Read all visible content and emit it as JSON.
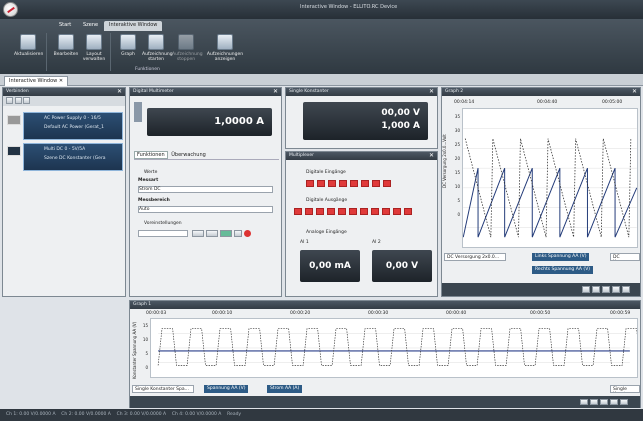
{
  "window": {
    "title": "Interactive Window - ELLITO.RC Device"
  },
  "ribbon": {
    "tabs": [
      "Start",
      "Szene",
      "Interaktive Window"
    ],
    "buttons": [
      "Aktualisieren",
      "Bearbeiten",
      "Layout verwalten",
      "Graph",
      "Aufzeichnung starten",
      "Aufzeichnung stoppen",
      "Aufzeichnungen anzeigen"
    ],
    "group_label": "Funktionen"
  },
  "document_tab": "Interactive Window",
  "devices": {
    "title": "Verbinden",
    "items": [
      {
        "name": "AC Power Supply 0 - 16/5",
        "sub": "Default AC Power (Gerat_1"
      },
      {
        "name": "Multi DC 0 - 5V/5A",
        "sub": "Szene DC Konstanter (Gera"
      }
    ]
  },
  "multimeter": {
    "title": "Digital Multimeter",
    "value": "1,0000 A",
    "tabs": [
      "Funktionen",
      "Überwachung"
    ],
    "section_values": "Werte",
    "mode_label": "Messart",
    "mode_value": "Strom DC",
    "range_label": "Messbereich",
    "range_value": "Auto",
    "section_presets": "Voreinstellungen"
  },
  "constant": {
    "title": "Single Konstanter",
    "voltage": "00,00 V",
    "current": "1,000 A"
  },
  "io": {
    "title": "Multiplexer",
    "din": "Digitale Eingänge",
    "dout": "Digitale Ausgänge",
    "ain": "Analoge Eingänge",
    "ai1_label": "AI 1",
    "ai2_label": "AI 2",
    "ai1": "0,00 mA",
    "ai2": "0,00 V"
  },
  "graph2": {
    "title": "Graph 2",
    "times": [
      "00:04:14",
      "00:04:40",
      "00:05:00"
    ],
    "ylabel": "DC Versorgung 2x0.0...Volt",
    "yticks": [
      "35",
      "30",
      "25",
      "20",
      "15",
      "10",
      "5",
      "0"
    ],
    "select": "DC Versorgung 2x0.0...",
    "leg1": "Links Spannung AA (V)",
    "leg2": "Rechts Spannung AA (V)",
    "select2": "DC Versorgung"
  },
  "graph1": {
    "title": "Graph 1",
    "times": [
      "00:00:03",
      "00:00:10",
      "00:00:20",
      "00:00:30",
      "00:00:40",
      "00:00:50",
      "00:00:59"
    ],
    "ylabel": "Konstanter Spannung AA (V)",
    "yticks": [
      "15",
      "10",
      "5",
      "0"
    ],
    "select": "Single Konstanter Spa...",
    "leg1": "Spannung AA (V)",
    "leg2": "Strom AA (A)",
    "select2": "Single Konst"
  },
  "status": [
    "Ch 1: 0.00 V/0.0000 A",
    "Ch 2: 0.00 V/0.0000 A",
    "Ch 3: 0.00 V/0.0000 A",
    "Ch 4: 0.00 V/0.0000 A",
    "Ready"
  ]
}
